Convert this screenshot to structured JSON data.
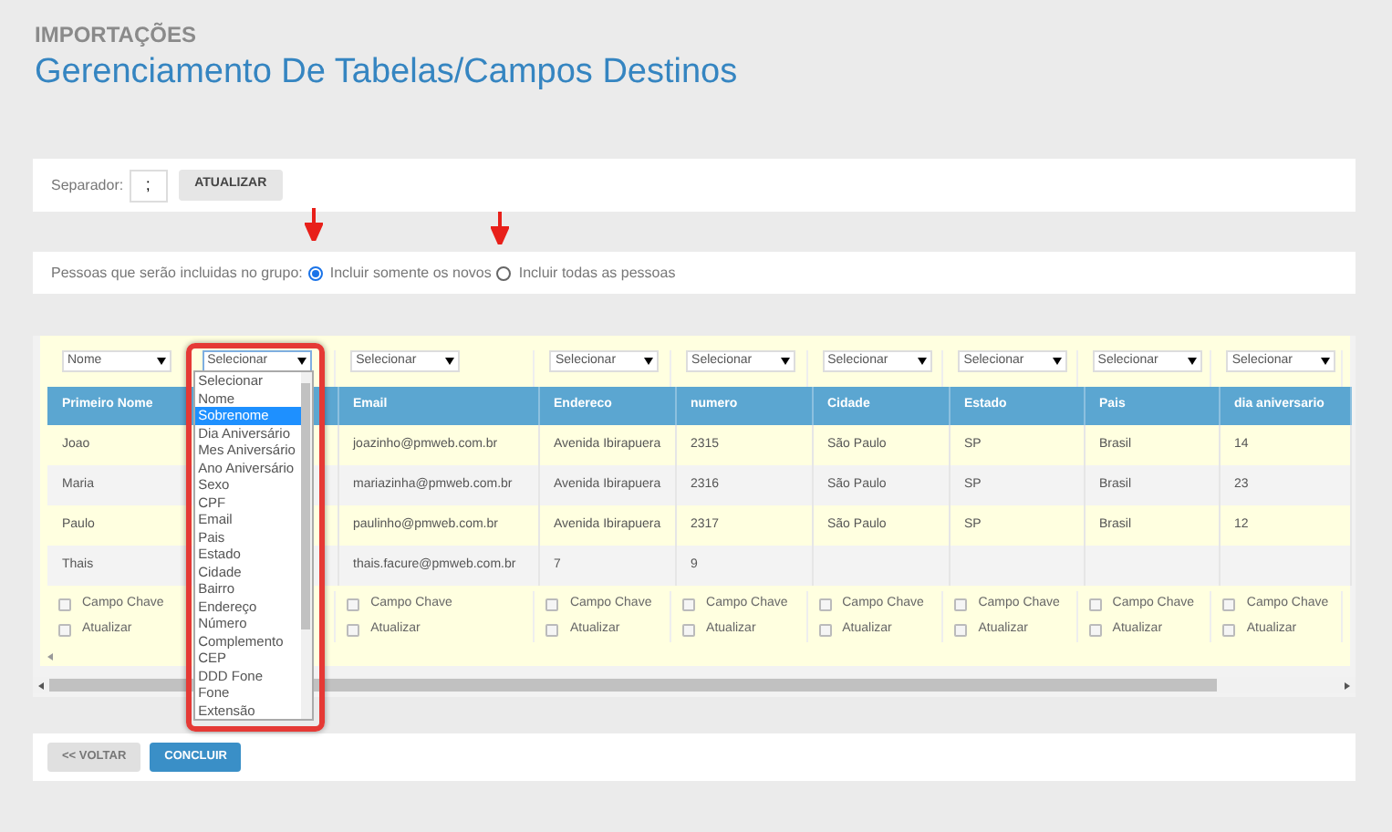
{
  "page": {
    "section": "IMPORTAÇÕES",
    "title": "Gerenciamento De Tabelas/Campos Destinos"
  },
  "separator": {
    "label": "Separador:",
    "value": ";",
    "button": "ATUALIZAR"
  },
  "group": {
    "label": "Pessoas que serão incluidas no grupo:",
    "options": [
      {
        "label": "Incluir somente os novos",
        "selected": true
      },
      {
        "label": "Incluir todas as pessoas",
        "selected": false
      }
    ]
  },
  "table": {
    "columns": [
      {
        "select": "Nome",
        "expanded": false,
        "header": "Primeiro Nome"
      },
      {
        "select": "Selecionar",
        "expanded": true,
        "options": [
          {
            "label": "Selecionar",
            "selected": false
          },
          {
            "label": "Nome",
            "selected": false
          },
          {
            "label": "Sobrenome",
            "selected": true
          },
          {
            "label": "Dia Aniversário",
            "selected": false
          },
          {
            "label": "Mes Aniversário",
            "selected": false
          },
          {
            "label": "Ano Aniversário",
            "selected": false
          },
          {
            "label": "Sexo",
            "selected": false
          },
          {
            "label": "CPF",
            "selected": false
          },
          {
            "label": "Email",
            "selected": false
          },
          {
            "label": "Pais",
            "selected": false
          },
          {
            "label": "Estado",
            "selected": false
          },
          {
            "label": "Cidade",
            "selected": false
          },
          {
            "label": "Bairro",
            "selected": false
          },
          {
            "label": "Endereço",
            "selected": false
          },
          {
            "label": "Número",
            "selected": false
          },
          {
            "label": "Complemento",
            "selected": false
          },
          {
            "label": "CEP",
            "selected": false
          },
          {
            "label": "DDD Fone",
            "selected": false
          },
          {
            "label": "Fone",
            "selected": false
          },
          {
            "label": "Extensão",
            "selected": false
          }
        ]
      },
      {
        "select": "Selecionar",
        "expanded": false,
        "header": "Email"
      },
      {
        "select": "Selecionar",
        "expanded": false,
        "header": "Endereco"
      },
      {
        "select": "Selecionar",
        "expanded": false,
        "header": "numero"
      },
      {
        "select": "Selecionar",
        "expanded": false,
        "header": "Cidade"
      },
      {
        "select": "Selecionar",
        "expanded": false,
        "header": "Estado"
      },
      {
        "select": "Selecionar",
        "expanded": false,
        "header": "Pais"
      },
      {
        "select": "Selecionar",
        "expanded": false,
        "header": "dia aniversario"
      }
    ],
    "rows": [
      {
        "cells": [
          "Joao",
          null,
          "joazinho@pmweb.com.br",
          "Avenida Ibirapuera",
          "2315",
          "São Paulo",
          "SP",
          "Brasil",
          "14"
        ]
      },
      {
        "cells": [
          "Maria",
          null,
          "mariazinha@pmweb.com.br",
          "Avenida Ibirapuera",
          "2316",
          "São Paulo",
          "SP",
          "Brasil",
          "23"
        ]
      },
      {
        "cells": [
          "Paulo",
          null,
          "paulinho@pmweb.com.br",
          "Avenida Ibirapuera",
          "2317",
          "São Paulo",
          "SP",
          "Brasil",
          "12"
        ]
      },
      {
        "cells": [
          "Thais",
          null,
          "thais.facure@pmweb.com.br",
          "7",
          "9",
          null,
          null,
          null,
          null
        ]
      }
    ],
    "flag_rows": [
      {
        "cells": [
          {
            "label": "Campo Chave",
            "checked": false
          },
          null,
          {
            "label": "Campo Chave",
            "checked": false
          },
          {
            "label": "Campo Chave",
            "checked": false
          },
          {
            "label": "Campo Chave",
            "checked": false
          },
          {
            "label": "Campo Chave",
            "checked": false
          },
          {
            "label": "Campo Chave",
            "checked": false
          },
          {
            "label": "Campo Chave",
            "checked": false
          },
          {
            "label": "Campo Chave",
            "checked": false
          }
        ]
      },
      {
        "cells": [
          {
            "label": "Atualizar",
            "checked": false
          },
          null,
          {
            "label": "Atualizar",
            "checked": false
          },
          {
            "label": "Atualizar",
            "checked": false
          },
          {
            "label": "Atualizar",
            "checked": false
          },
          {
            "label": "Atualizar",
            "checked": false
          },
          {
            "label": "Atualizar",
            "checked": false
          },
          {
            "label": "Atualizar",
            "checked": false
          },
          {
            "label": "Atualizar",
            "checked": false
          }
        ]
      }
    ]
  },
  "buttons": [
    {
      "label": "<< VOLTAR",
      "kind": "secondary"
    },
    {
      "label": "CONCLUIR",
      "kind": "primary"
    }
  ]
}
